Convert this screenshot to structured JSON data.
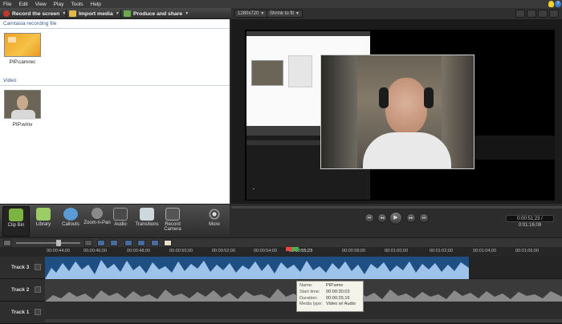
{
  "menu": [
    "File",
    "Edit",
    "View",
    "Play",
    "Tools",
    "Help"
  ],
  "toolbar": {
    "record_label": "Record the screen",
    "import_label": "Import media",
    "produce_label": "Produce and share"
  },
  "preview_toolbar": {
    "size_label": "1280x720",
    "zoom_label": "Shrink to fit"
  },
  "clip_bin": {
    "section_recording": "Camtasia recording file",
    "section_video": "Video",
    "items": [
      {
        "label": "PIP.camrec"
      },
      {
        "label": "PIP.wmv"
      }
    ]
  },
  "tools": [
    {
      "label": "Clip Bin",
      "icon": "clip-bin-icon"
    },
    {
      "label": "Library",
      "icon": "library-icon"
    },
    {
      "label": "Callouts",
      "icon": "callouts-icon"
    },
    {
      "label": "Zoom-n-Pan",
      "icon": "zoom-n-pan-icon"
    },
    {
      "label": "Audio",
      "icon": "audio-icon"
    },
    {
      "label": "Transitions",
      "icon": "transitions-icon"
    },
    {
      "label": "Record Camera",
      "icon": "camera-icon"
    },
    {
      "label": "More",
      "icon": "more-icon"
    }
  ],
  "player": {
    "time_display": "0:00:51;23 / 0:01:16;08"
  },
  "timeline": {
    "ruler_labels": [
      "00:00:44;00",
      "00:00:46;00",
      "00:00:48;00",
      "00:00:50;00",
      "00:00:52;00",
      "00:00:54;00",
      "00:00:55;23",
      "00:00:58;00",
      "00:01:00;00",
      "00:01:02;00",
      "00:01:04;00",
      "00:01:06;00"
    ],
    "tracks": [
      "Track 3",
      "Track 2",
      "Track 1"
    ]
  },
  "tooltip": {
    "name_key": "Name:",
    "name_val": "PIP.wmv",
    "start_key": "Start time:",
    "start_val": "00:00:30;03",
    "dur_key": "Duration:",
    "dur_val": "00:00:25;16",
    "type_key": "Media type:",
    "type_val": "Video w/ Audio"
  },
  "colors": {
    "accent": "#3c5a8a",
    "audio_wave": "#6fa0d8",
    "track3_bg": "#1f4f82"
  }
}
